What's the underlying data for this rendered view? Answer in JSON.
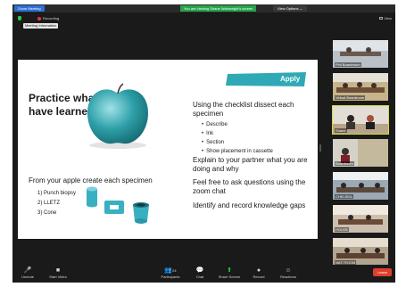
{
  "title_bar": {
    "app_title": "Zoom Meeting",
    "viewing_notice": "You are viewing Shane Wainwright's screen",
    "view_options": "View Options"
  },
  "status": {
    "recording_label": "Recording",
    "view_label": "View",
    "tooltip": "Meeting Information"
  },
  "slide": {
    "heading": "Practice what you have learned",
    "apply_label": "Apply",
    "dissect_text": "Using the checklist dissect each specimen",
    "checklist": [
      "Describe",
      "Ink",
      "Section",
      "Show placement in cassette"
    ],
    "explain_text": "Explain to your partner what you are doing and why",
    "feel_text": "Feel free to ask questions using the zoom chat",
    "identify_text": "Identify and record knowledge gaps",
    "create_text": "From your apple create each specimen",
    "steps": [
      "1) Punch biopsy",
      "2) LLETZ",
      "3) Cone"
    ],
    "colors": {
      "banner": "#2fa9b5",
      "apple": "#2d9fa8",
      "specimen": "#38b0c2"
    }
  },
  "participants": [
    {
      "name": "Phil Boardroom"
    },
    {
      "name": "Virtual Boardroom"
    },
    {
      "name": "Shane"
    },
    {
      "name": "Boardroom"
    },
    {
      "name": "CHELSEA"
    },
    {
      "name": "HOUSE"
    },
    {
      "name": "NATI ROOM"
    }
  ],
  "toolbar": {
    "unmute": "Unmute",
    "start_video": "Start Video",
    "participants": "Participants",
    "participant_count": "24",
    "chat": "Chat",
    "share_screen": "Share Screen",
    "record": "Record",
    "reactions": "Reactions",
    "leave": "Leave",
    "colors": {
      "share_screen": "#28c840",
      "leave": "#e03e2d"
    }
  }
}
